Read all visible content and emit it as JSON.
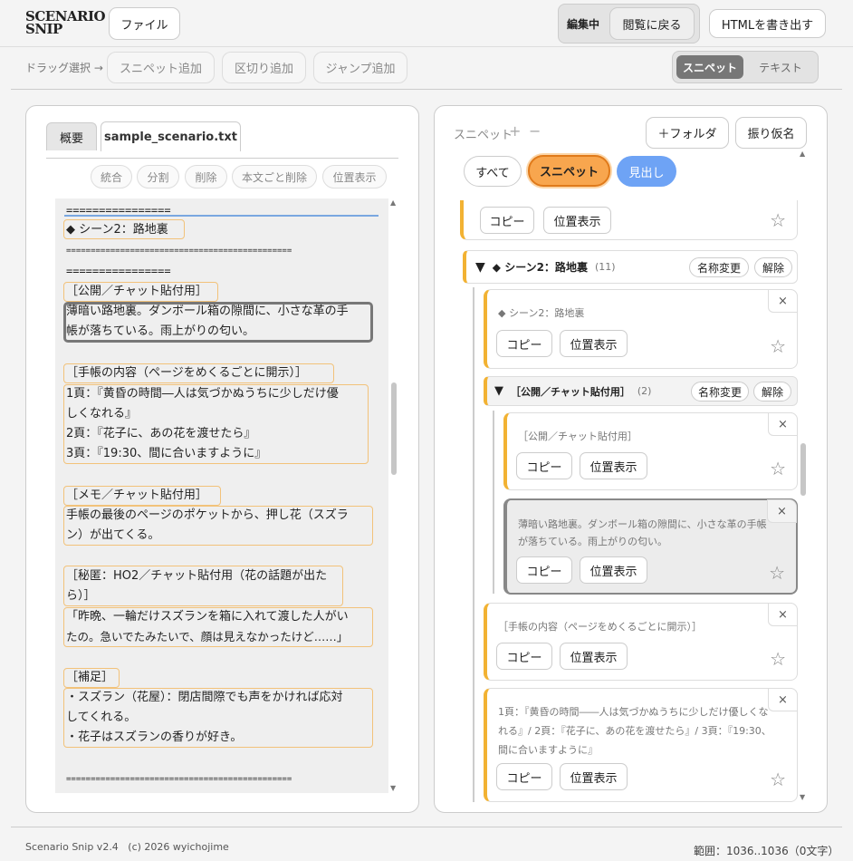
{
  "header": {
    "logo_line1": "SCENARIO",
    "logo_line2": "SNIP",
    "file_button": "ファイル",
    "mode_label": "編集中",
    "back_button": "閲覧に戻る",
    "export_button": "HTMLを書き出す"
  },
  "toolbar": {
    "hint": "ドラッグ選択 →",
    "add_snippet": "スニペット追加",
    "add_divider": "区切り追加",
    "add_jump": "ジャンプ追加",
    "view_snippet": "スニペット",
    "view_text": "テキスト"
  },
  "left": {
    "tabs": [
      "概要",
      "sample_scenario.txt"
    ],
    "actions": [
      "統合",
      "分割",
      "削除",
      "本文ごと削除",
      "位置表示"
    ],
    "lines": [
      "================",
      "◆ シーン2：路地裏",
      "==============================================",
      "================",
      "［公開／チャット貼付用］",
      "薄暗い路地裏。ダンボール箱の隙間に、小さな革の手",
      "帳が落ちている。雨上がりの匂い。",
      "",
      "［手帳の内容（ページをめくるごとに開示）］",
      "1頁：『黄昏の時間―人は気づかぬうちに少しだけ優",
      "しくなれる』",
      "2頁：『花子に、あの花を渡せたら』",
      "3頁：『19:30、間に合いますように』",
      "",
      "［メモ／チャット貼付用］",
      "手帳の最後のページのポケットから、押し花（スズラ",
      "ン）が出てくる。",
      "",
      "［秘匿：HO2／チャット貼付用（花の話題が出た",
      "ら）］",
      "「昨晩、一輪だけスズランを箱に入れて渡した人がい",
      "たの。急いでたみたいで、顔は見えなかったけど……」",
      "",
      "［補足］",
      "・スズラン（花屋）：閉店間際でも声をかければ応対",
      "してくれる。",
      "・花子はスズランの香りが好き。",
      "",
      "=============================================="
    ]
  },
  "right": {
    "title": "スニペット",
    "plus": "+",
    "minus": "−",
    "folder_button": "＋フォルダ",
    "ruby_button": "振り仮名",
    "filters": [
      "すべて",
      "スニペット",
      "見出し"
    ],
    "copy": "コピー",
    "locate": "位置表示",
    "close": "×",
    "star": "☆",
    "triangle": "▼",
    "rename": "名称変更",
    "release": "解除",
    "group1": {
      "title": "◆ シーン2：路地裏",
      "count": "(11)"
    },
    "group2": {
      "title": "［公開／チャット貼付用］",
      "count": "(2)"
    },
    "cards": [
      "◆ シーン2：路地裏",
      "［公開／チャット貼付用］",
      "薄暗い路地裏。ダンボール箱の隙間に、小さな革の手帳",
      "が落ちている。雨上がりの匂い。",
      "［手帳の内容（ページをめくるごとに開示）］",
      "1頁：『黄昏の時間――人は気づかぬうちに少しだけ優しくな",
      "れる』/ 2頁：『花子に、あの花を渡せたら』/ 3頁：『19:30、",
      "間に合いますように』"
    ]
  },
  "footer": {
    "version": "Scenario Snip v2.4   (c) 2026 wyichojime",
    "range": "範囲：1036..1036（0文字）"
  }
}
